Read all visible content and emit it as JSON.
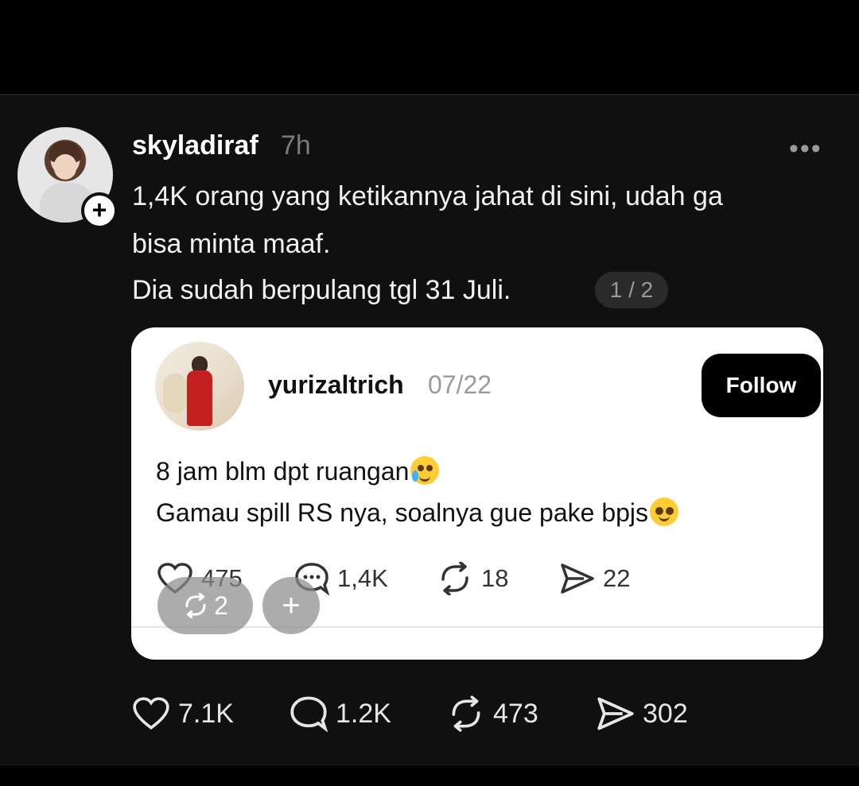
{
  "post": {
    "username": "skyladiraf",
    "time": "7h",
    "more_label": "•••",
    "follow_plus": "+",
    "lines": [
      "1,4K orang yang ketikannya jahat di sini, udah ga",
      "bisa minta maaf.",
      "Dia sudah berpulang tgl 31 Juli."
    ],
    "pager": "1 / 2",
    "stats": {
      "likes": "7.1K",
      "comments": "1.2K",
      "reposts": "473",
      "shares": "302"
    }
  },
  "quoted": {
    "username": "yurizaltrich",
    "date": "07/22",
    "follow_label": "Follow",
    "line1": "8 jam blm dpt ruangan",
    "line2": "Gamau spill RS nya, soalnya gue pake bpjs",
    "stats": {
      "likes": "475",
      "comments": "1,4K",
      "reposts": "18",
      "shares": "22"
    }
  },
  "overlay": {
    "repost_count": "2",
    "plus_label": "+"
  },
  "icons": {
    "like": "heart-icon",
    "comment": "comment-bubble-icon",
    "repost": "repost-arrows-icon",
    "share": "send-icon",
    "more": "more-dots-icon"
  }
}
